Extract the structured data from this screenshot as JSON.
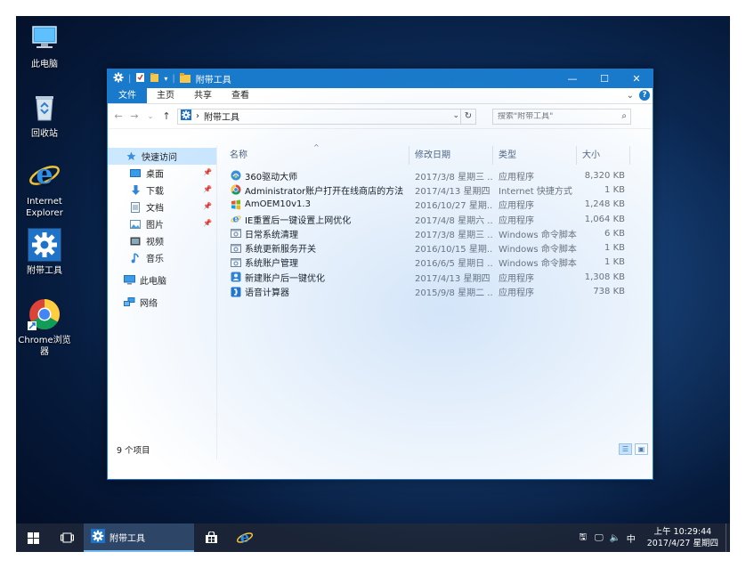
{
  "desktop": {
    "icons": [
      {
        "label": "此电脑"
      },
      {
        "label": "回收站"
      },
      {
        "label": "Internet Explorer"
      },
      {
        "label": "附带工具"
      },
      {
        "label": "Chrome浏览器"
      }
    ]
  },
  "window": {
    "title": "附带工具",
    "controls": {
      "minimize": "—",
      "maximize": "☐",
      "close": "✕"
    }
  },
  "ribbon": {
    "tabs": [
      "文件",
      "主页",
      "共享",
      "查看"
    ],
    "expand": "⌄",
    "help": "?"
  },
  "address": {
    "back": "←",
    "forward": "→",
    "recent": "⌄",
    "up": "↑",
    "separator": "›",
    "path": "附带工具",
    "search_placeholder": "搜索\"附带工具\""
  },
  "nav_pane": {
    "items": [
      {
        "label": "快速访问",
        "icon": "star-icon"
      },
      {
        "label": "桌面",
        "icon": "desktop-icon"
      },
      {
        "label": "下载",
        "icon": "download-icon"
      },
      {
        "label": "文档",
        "icon": "document-icon"
      },
      {
        "label": "图片",
        "icon": "picture-icon"
      },
      {
        "label": "视频",
        "icon": "video-icon"
      },
      {
        "label": "音乐",
        "icon": "music-icon"
      },
      {
        "label": "此电脑",
        "icon": "pc-icon"
      },
      {
        "label": "网络",
        "icon": "network-icon"
      }
    ]
  },
  "columns": {
    "name": "名称",
    "date": "修改日期",
    "type": "类型",
    "size": "大小"
  },
  "files": [
    {
      "name": "360驱动大师",
      "date": "2017/3/8 星期三 ...",
      "type": "应用程序",
      "size": "8,320 KB",
      "icon": "gear-app-icon"
    },
    {
      "name": "Administrator账户打开在线商店的方法",
      "date": "2017/4/13 星期四 ...",
      "type": "Internet 快捷方式",
      "size": "1 KB",
      "icon": "chrome-shortcut-icon"
    },
    {
      "name": "AmOEM10v1.3",
      "date": "2016/10/27 星期...",
      "type": "应用程序",
      "size": "1,248 KB",
      "icon": "windows-logo-icon"
    },
    {
      "name": "IE重置后一键设置上网优化",
      "date": "2017/4/8 星期六 ...",
      "type": "应用程序",
      "size": "1,064 KB",
      "icon": "ie-icon"
    },
    {
      "name": "日常系统清理",
      "date": "2017/3/8 星期三 ...",
      "type": "Windows 命令脚本",
      "size": "6 KB",
      "icon": "script-icon"
    },
    {
      "name": "系统更新服务开关",
      "date": "2016/10/15 星期...",
      "type": "Windows 命令脚本",
      "size": "1 KB",
      "icon": "script-icon"
    },
    {
      "name": "系统账户管理",
      "date": "2016/6/5 星期日 ...",
      "type": "Windows 命令脚本",
      "size": "1 KB",
      "icon": "script-icon"
    },
    {
      "name": "新建账户后一键优化",
      "date": "2017/4/13 星期四 ...",
      "type": "应用程序",
      "size": "1,308 KB",
      "icon": "user-app-icon"
    },
    {
      "name": "语音计算器",
      "date": "2015/9/8 星期二 ...",
      "type": "应用程序",
      "size": "738 KB",
      "icon": "calculator-icon"
    }
  ],
  "status": {
    "count": "9 个项目"
  },
  "taskbar": {
    "active_app": "附带工具",
    "clock_time": "上午 10:29:44",
    "clock_date": "2017/4/27 星期四",
    "ime": "中"
  },
  "colors": {
    "accent": "#1979ca",
    "taskbar": "#1a2436"
  }
}
